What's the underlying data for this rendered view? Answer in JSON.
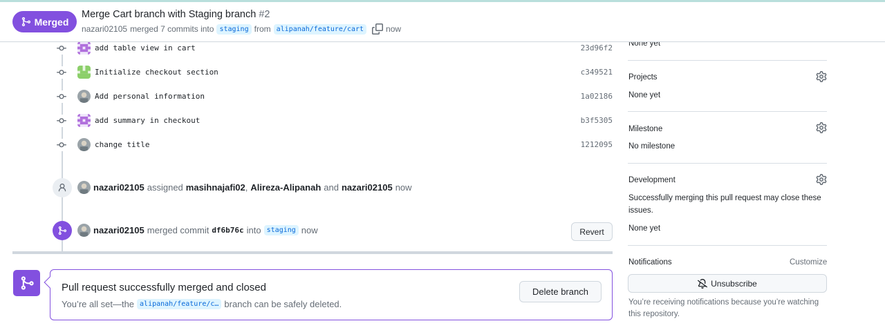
{
  "header": {
    "status_label": "Merged",
    "title": "Merge Cart branch with Staging branch",
    "number": "#2",
    "author": "nazari02105",
    "merged_text": "merged 7 commits into",
    "base_branch": "staging",
    "from_text": "from",
    "head_branch": "alipanah/feature/cart",
    "time": "now"
  },
  "commits": [
    {
      "message": "add table view in cart",
      "sha": "23d96f2",
      "avatar": "purple-identicon"
    },
    {
      "message": "Initialize checkout section",
      "sha": "c349521",
      "avatar": "green-identicon"
    },
    {
      "message": "Add personal information",
      "sha": "1a02186",
      "avatar": "photo-avatar"
    },
    {
      "message": "add summary in checkout",
      "sha": "b3f5305",
      "avatar": "purple-identicon"
    },
    {
      "message": "change title",
      "sha": "1212095",
      "avatar": "photo-avatar"
    }
  ],
  "assign_event": {
    "actor": "nazari02105",
    "verb": "assigned",
    "assignee1": "masihnajafi02",
    "comma": ",",
    "assignee2": "Alireza-Alipanah",
    "and_text": "and",
    "assignee3": "nazari02105",
    "time": "now"
  },
  "merge_event": {
    "actor": "nazari02105",
    "verb": "merged commit",
    "commit": "df6b76c",
    "into_text": "into",
    "branch": "staging",
    "time": "now",
    "revert_label": "Revert"
  },
  "merge_box": {
    "title": "Pull request successfully merged and closed",
    "prefix": "You’re all set—the",
    "branch": "alipanah/feature/c…",
    "suffix": "branch can be safely deleted.",
    "delete_label": "Delete branch"
  },
  "sidebar": {
    "top_value": "None yet",
    "projects": {
      "heading": "Projects",
      "value": "None yet"
    },
    "milestone": {
      "heading": "Milestone",
      "value": "No milestone"
    },
    "development": {
      "heading": "Development",
      "description": "Successfully merging this pull request may close these issues.",
      "value": "None yet"
    },
    "notifications": {
      "heading": "Notifications",
      "customize": "Customize",
      "unsubscribe_label": "Unsubscribe",
      "note": "You’re receiving notifications because you’re watching this repository."
    }
  },
  "colors": {
    "merged_purple": "#8250df",
    "branch_chip_bg": "#ddf4ff",
    "branch_chip_text": "#0969da"
  }
}
